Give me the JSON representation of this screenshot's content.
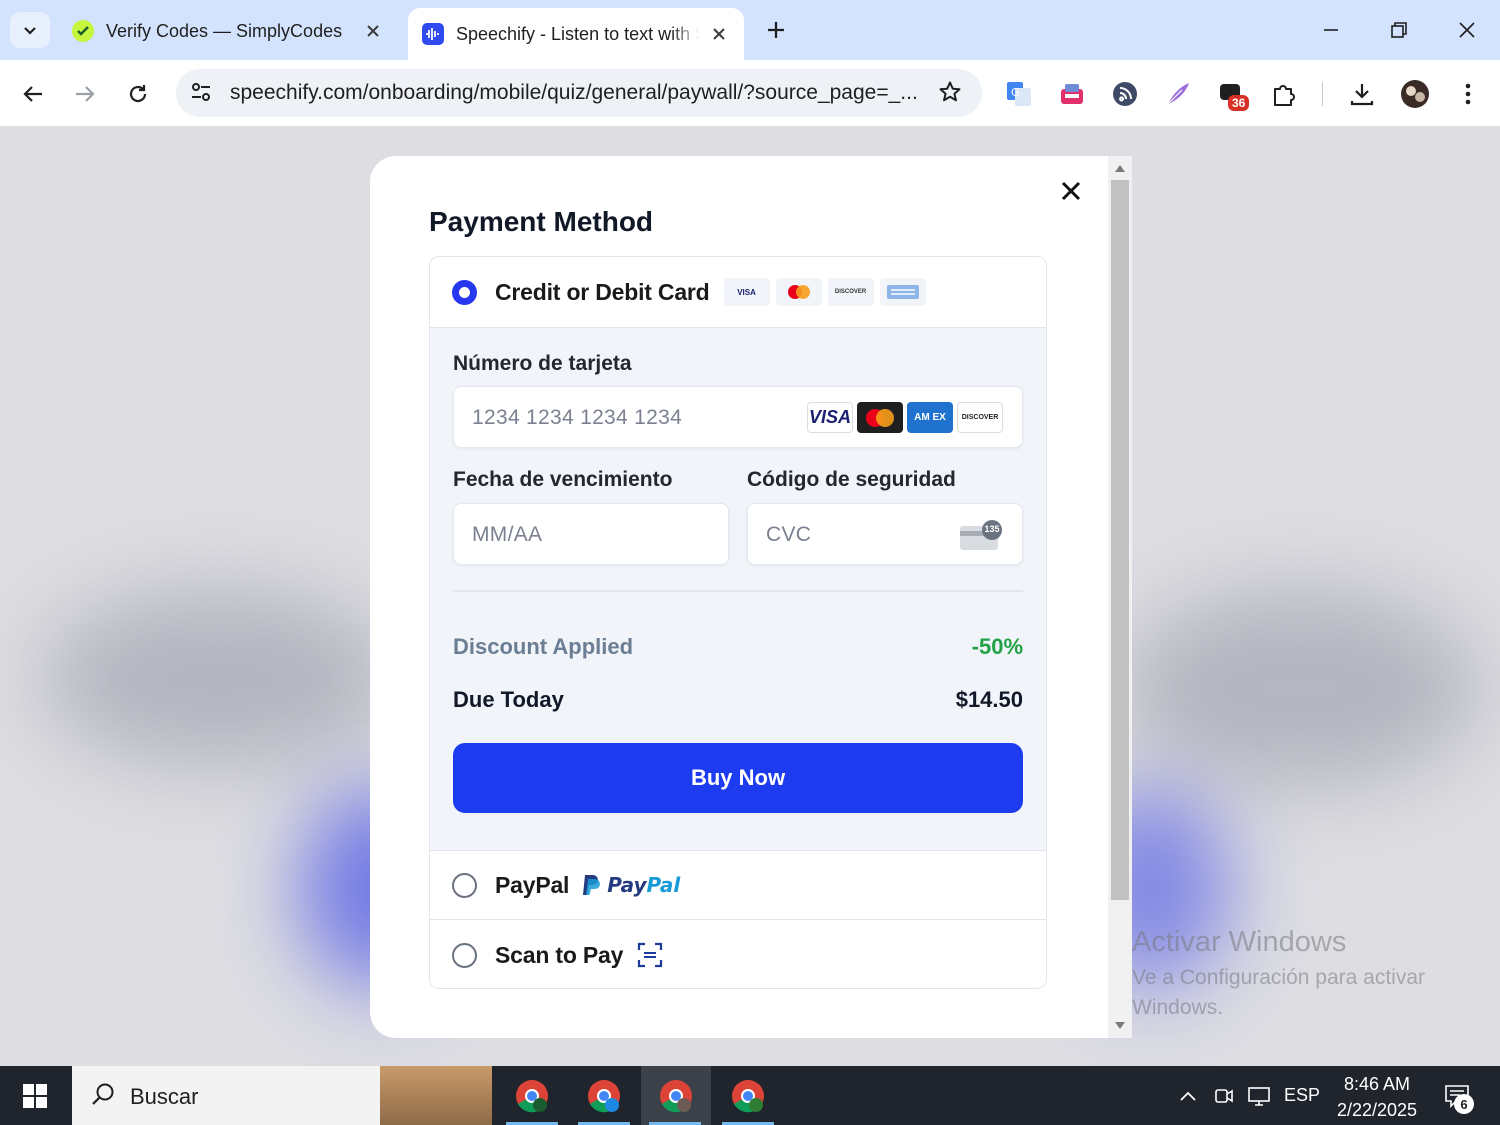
{
  "browser": {
    "tabs": [
      {
        "title": "Verify Codes — SimplyCodes",
        "active": false
      },
      {
        "title": "Speechify - Listen to text with Speechify",
        "active": true
      }
    ],
    "url": "speechify.com/onboarding/mobile/quiz/general/paywall/?source_page=_...",
    "extension_badge": "36"
  },
  "modal": {
    "title": "Payment Method",
    "card_option": {
      "label": "Credit or Debit Card",
      "selected": true,
      "mini_brands": [
        "VISA",
        "DISCOVER"
      ]
    },
    "card_form": {
      "number_label": "Número de tarjeta",
      "number_placeholder": "1234 1234 1234 1234",
      "brand_visa": "VISA",
      "brand_amex": "AM EX",
      "brand_discover": "DISCOVER",
      "expiry_label": "Fecha de vencimiento",
      "expiry_placeholder": "MM/AA",
      "cvc_label": "Código de seguridad",
      "cvc_placeholder": "CVC",
      "cvc_hint_number": "135"
    },
    "summary": {
      "discount_label": "Discount Applied",
      "discount_value": "-50%",
      "due_label": "Due Today",
      "due_value": "$14.50"
    },
    "buy_button": "Buy Now",
    "paypal_option": {
      "label": "PayPal",
      "logo_part1": "Pay",
      "logo_part2": "Pal",
      "selected": false
    },
    "scan_option": {
      "label": "Scan to Pay",
      "selected": false
    }
  },
  "watermark": {
    "title": "Activar Windows",
    "line1": "Ve a Configuración para activar",
    "line2": "Windows."
  },
  "taskbar": {
    "search_label": "Buscar",
    "language": "ESP",
    "time": "8:46 AM",
    "date": "2/22/2025",
    "notifications": "6"
  },
  "colors": {
    "accent": "#1d3cf0",
    "discount_green": "#22a146",
    "radio_selected": "#2538f0"
  }
}
